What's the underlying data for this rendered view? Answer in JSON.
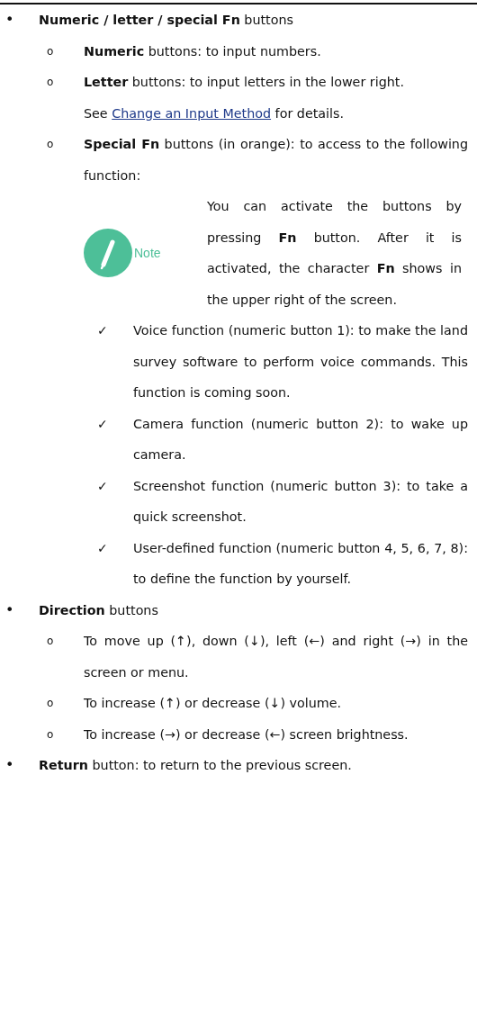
{
  "items": [
    {
      "kind": "bullet",
      "marker": "•",
      "text": "**Numeric / letter / special Fn** buttons",
      "children": [
        {
          "kind": "circle",
          "marker": "o",
          "text": "**Numeric** buttons: to input numbers."
        },
        {
          "kind": "circle",
          "marker": "o",
          "text": "**Letter** buttons: to input letters in the lower right.",
          "see_also": {
            "before": "See",
            "link": "Change an Input Method",
            "after": "for details."
          }
        },
        {
          "kind": "circle",
          "marker": "o",
          "text": "**Special Fn** buttons (in orange): to access to the following function:",
          "note": {
            "label": "Note",
            "text": "You can activate the buttons by pressing **Fn** button. After it is activated, the character **Fn** shows in the upper right of the screen."
          },
          "children": [
            {
              "kind": "check",
              "marker": "✓",
              "text": "Voice function (numeric button 1): to make the land survey software to perform voice commands. This function is coming soon."
            },
            {
              "kind": "check",
              "marker": "✓",
              "text": "Camera function (numeric button 2): to wake up camera."
            },
            {
              "kind": "check",
              "marker": "✓",
              "text": "Screenshot function (numeric button 3): to take a quick screenshot."
            },
            {
              "kind": "check",
              "marker": "✓",
              "text": "User-defined function (numeric button 4, 5, 6, 7, 8): to define the function by yourself."
            }
          ]
        }
      ]
    },
    {
      "kind": "bullet",
      "marker": "•",
      "text": "**Direction** buttons",
      "children": [
        {
          "kind": "circle",
          "marker": "o",
          "text": "To move up (↑), down (↓), left (←) and right (→) in the screen or menu."
        },
        {
          "kind": "circle",
          "marker": "o",
          "text": "To increase (↑) or decrease (↓) volume."
        },
        {
          "kind": "circle",
          "marker": "o",
          "text": "To increase (→) or decrease (←) screen brightness."
        }
      ]
    },
    {
      "kind": "bullet",
      "marker": "•",
      "text": "**Return** button: to return to the previous screen."
    }
  ]
}
